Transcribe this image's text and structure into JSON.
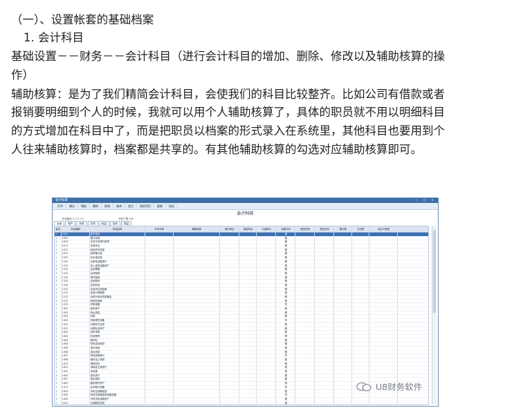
{
  "doc": {
    "heading": "（一）、设置帐套的基础档案",
    "subheading": "1. 会计科目",
    "line1": "基础设置－－财务－－会计科目（进行会计科目的增加、删除、修改以及辅助核算的操",
    "line2": "作）",
    "line3": "辅助核算：是为了我们精简会计科目，会使我们的科目比较整齐。比如公司有借款或者",
    "line4": "报销要明细到个人的时候，我就可以用个人辅助核算了，具体的职员就不用以明细科目",
    "line5": "的方式增加在科目中了，而是把职员以档案的形式录入在系统里，其他科目也要用到个",
    "line6": "人往来辅助核算时，档案都是共享的。有其他辅助核算的勾选对应辅助核算即可。"
  },
  "screenshot": {
    "window_title": "会计科目",
    "window_controls": "－ □ ×",
    "toolbar": [
      "打印",
      "输出",
      "增加",
      "删除",
      "修改",
      "查询",
      "定位",
      "指定科目",
      "复制",
      "退出"
    ],
    "center_title": "会计科目",
    "meta_left": "科目级长 4-2-2-2-2",
    "meta_right": "科目个数 190",
    "tabs": [
      "全部",
      "资产",
      "负债",
      "共同",
      "权益",
      "成本",
      "损益"
    ],
    "columns": [
      "级次",
      "科目编码",
      "科目名称",
      "外币币种",
      "辅助核算",
      "银行科目",
      "现金科目",
      "计量单位",
      "余额方向",
      "受控系统",
      "是否封存",
      "银行账",
      "日记账",
      "自定义类型"
    ],
    "rows": [
      [
        "1",
        "1001",
        "库存现金",
        "借"
      ],
      [
        "1",
        "1002",
        "银行存款",
        "借"
      ],
      [
        "1",
        "1003",
        "存放中央银行款项",
        "借"
      ],
      [
        "1",
        "1011",
        "存放同业",
        "借"
      ],
      [
        "1",
        "1012",
        "其他货币资金",
        "借"
      ],
      [
        "1",
        "1021",
        "结算备付金",
        "借"
      ],
      [
        "1",
        "1031",
        "存出保证金",
        "借"
      ],
      [
        "1",
        "1101",
        "交易性金融资产",
        "借"
      ],
      [
        "1",
        "1111",
        "买入返售金融资产",
        "借"
      ],
      [
        "1",
        "1121",
        "应收票据",
        "借"
      ],
      [
        "1",
        "1122",
        "应收账款",
        "借"
      ],
      [
        "1",
        "1123",
        "预付账款",
        "借"
      ],
      [
        "1",
        "1131",
        "应收股利",
        "借"
      ],
      [
        "1",
        "1132",
        "应收利息",
        "借"
      ],
      [
        "1",
        "1201",
        "应收代位追偿款",
        "借"
      ],
      [
        "1",
        "1211",
        "应收分保账款",
        "借"
      ],
      [
        "1",
        "1212",
        "应收分保合同准备金",
        "借"
      ],
      [
        "1",
        "1221",
        "其他应收款",
        "借"
      ],
      [
        "1",
        "1231",
        "坏账准备",
        "贷"
      ],
      [
        "1",
        "1301",
        "贴现资产",
        "借"
      ],
      [
        "1",
        "1302",
        "拆出资金",
        "借"
      ],
      [
        "1",
        "1303",
        "贷款",
        "借"
      ],
      [
        "1",
        "1304",
        "贷款损失准备",
        "贷"
      ],
      [
        "1",
        "1311",
        "代理兑付证券",
        "借"
      ],
      [
        "1",
        "1321",
        "代理业务资产",
        "借"
      ],
      [
        "1",
        "1401",
        "材料采购",
        "借"
      ],
      [
        "1",
        "1402",
        "在途物资",
        "借"
      ],
      [
        "1",
        "1403",
        "原材料",
        "借"
      ],
      [
        "1",
        "1404",
        "材料成本差异",
        "借"
      ],
      [
        "1",
        "1405",
        "库存商品",
        "借"
      ],
      [
        "1",
        "1406",
        "发出商品",
        "借"
      ],
      [
        "1",
        "1407",
        "商品进销差价",
        "贷"
      ],
      [
        "1",
        "1408",
        "委托加工物资",
        "借"
      ],
      [
        "1",
        "1411",
        "周转材料",
        "借"
      ],
      [
        "1",
        "1421",
        "消耗性生物资产",
        "借"
      ],
      [
        "1",
        "1431",
        "贵金属",
        "借"
      ],
      [
        "1",
        "1441",
        "抵债资产",
        "借"
      ],
      [
        "1",
        "1451",
        "损余物资",
        "借"
      ],
      [
        "1",
        "1461",
        "融资租赁资产",
        "借"
      ],
      [
        "1",
        "1471",
        "存货跌价准备",
        "贷"
      ],
      [
        "1",
        "1501",
        "持有至到期投资",
        "借"
      ],
      [
        "1",
        "1502",
        "持有至到期投资减值准备",
        "贷"
      ],
      [
        "1",
        "1503",
        "可供出售金融资产",
        "借"
      ],
      [
        "1",
        "1511",
        "长期股权投资",
        "借"
      ]
    ],
    "watermark": "U8财务软件"
  }
}
